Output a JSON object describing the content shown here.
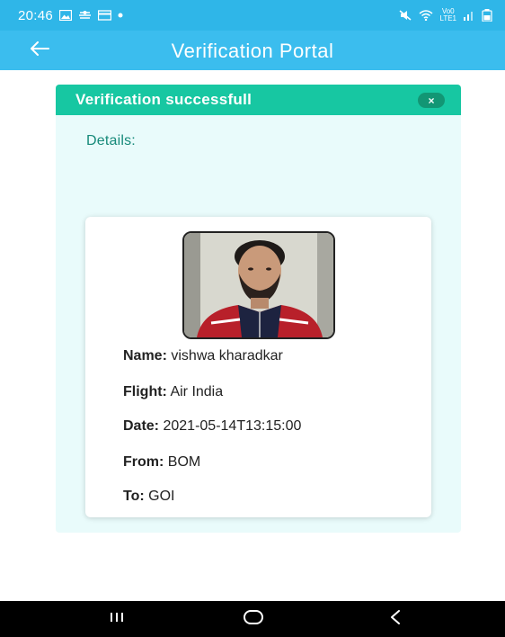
{
  "status_bar": {
    "time": "20:46",
    "network_label_top": "Vo0",
    "network_label_bottom": "LTE1"
  },
  "app_bar": {
    "title": "Verification Portal"
  },
  "alert": {
    "message": "Verification successfull",
    "close_symbol": "×"
  },
  "details": {
    "label": "Details:"
  },
  "card": {
    "fields": [
      {
        "key": "Name:",
        "value": "vishwa kharadkar"
      },
      {
        "key": "Flight:",
        "value": "Air India"
      },
      {
        "key": "Date:",
        "value": "2021-05-14T13:15:00"
      },
      {
        "key": "From:",
        "value": "BOM"
      },
      {
        "key": "To:",
        "value": "GOI"
      }
    ]
  },
  "colors": {
    "app_bar": "#3bbdee",
    "alert_header": "#17c7a2",
    "panel_bg": "#e9fbfb",
    "nav_bar": "#000000"
  },
  "icons": {
    "back": "arrow-left-icon",
    "close": "close-icon",
    "nav_recents": "recents-icon",
    "nav_home": "home-icon",
    "nav_back": "nav-back-icon"
  }
}
